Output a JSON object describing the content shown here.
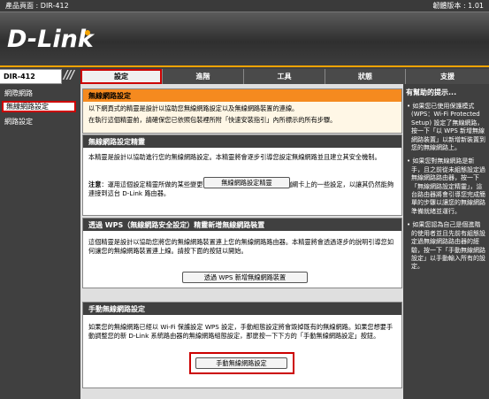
{
  "topbar": {
    "product": "產品頁面 : DIR-412",
    "firmware": "韌體版本 : 1.01"
  },
  "brand": {
    "logo": "D-Link"
  },
  "nav": {
    "model": "DIR-412",
    "slashes": "///",
    "tabs": [
      "設定",
      "進階",
      "工具",
      "狀態",
      "支援"
    ]
  },
  "sidebar": {
    "items": [
      "網際網路",
      "無線網路設定",
      "網路設定"
    ]
  },
  "main": {
    "intro": {
      "title": "無線網路設定",
      "line1": "以下網頁式的精靈是設計以協助您無線網路設定以及無線網路裝置的連線。",
      "line2": "在執行這個精靈前，請確保您已依照包裝裡所附「快速安裝指引」內所標示的所有步驟。"
    },
    "wizard": {
      "title": "無線網路設定精靈",
      "text": "本精靈是設計以協助進行您的無線網路設定。本精靈將會逐步引導您設定無線網路並且建立其安全機制。",
      "button": "無線網路設定精靈",
      "note_label": "注意",
      "note": "：運用這個設定精靈所做的某些變更可能需要您變更無線網路用戶端綱卡上的一些設定，以讓其仍然能夠連接到這台 D-Link 路由器。"
    },
    "wps": {
      "title": "透過 WPS（無線網路安全設定）精靈新增無線網路裝置",
      "text": "這個精靈是設計以協助您將您的無線網路裝置連上您的無線網路路由器。本精靈將會透過逐步的說明引導您如何讓您的無線網路裝置連上線。請按下面的按鈕以開始。",
      "button": "透過 WPS 新增無線網路裝置"
    },
    "manual": {
      "title": "手動無線網路設定",
      "text": "如果您的無線網路已經以 Wi-Fi 保護設定 WPS 設定，手動組態設定將會毀掉既有的無線網路。如果您想要手動調整您的新 D-Link 系統路由器的無線網路組態設定，那麼按一下下方的「手動無線網路設定」按鈕。",
      "button": "手動無線網路設定"
    }
  },
  "help": {
    "title": "有幫助的提示...",
    "tips": [
      "• 如果您已使用保護模式 (WPS：Wi-Fi Protected Setup) 設定了無線網路，按一下「以 WPS 新增無線網路裝置」以新增新裝置到您的無線網路上。",
      "• 如果您對無線網路是新手，且之前從未組態設定過無線網路路由器，按一下「無線網路設定精靈」，這台路由器將會引導您完成簡單的步驟以讓您的無線網路準備就緒並運行。",
      "• 如果您認為自己是個進階的使用者並且先前有組態設定過無線網路路由器的經驗，按一下「手動無線網路設定」以手動輸入所有的設定。"
    ]
  },
  "colors": {
    "accent": "#f58a1f",
    "highlight": "#cc0000",
    "dark": "#404040"
  }
}
